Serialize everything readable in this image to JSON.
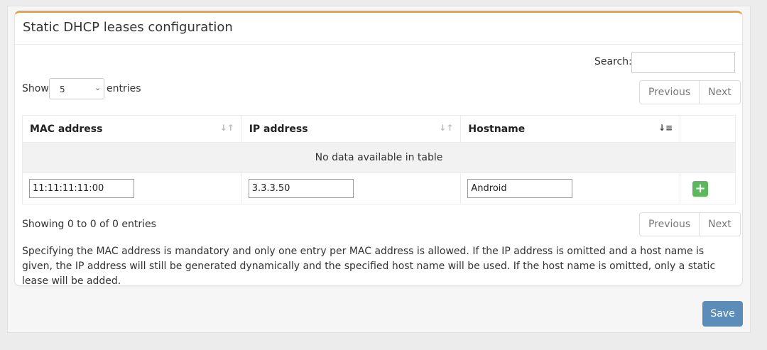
{
  "card": {
    "title": "Static DHCP leases configuration"
  },
  "search": {
    "label": "Search:",
    "value": ""
  },
  "length": {
    "show_label": "Show",
    "selected": "5",
    "entries_label": "entries"
  },
  "pager": {
    "previous": "Previous",
    "next": "Next"
  },
  "table": {
    "columns": [
      "MAC address",
      "IP address",
      "Hostname"
    ],
    "empty_message": "No data available in table",
    "new_row": {
      "mac": "11:11:11:11:00",
      "ip": "3.3.3.50",
      "hostname": "Android",
      "add_label": "+"
    }
  },
  "info": "Showing 0 to 0 of 0 entries",
  "help": "Specifying the MAC address is mandatory and only one entry per MAC address is allowed. If the IP address is omitted and a host name is given, the IP address will still be generated dynamically and the specified host name will be used. If the host name is omitted, only a static lease will be added.",
  "save_label": "Save",
  "colors": {
    "accent": "#e8a33c",
    "save": "#5b8db8",
    "add": "#5cb85c"
  }
}
